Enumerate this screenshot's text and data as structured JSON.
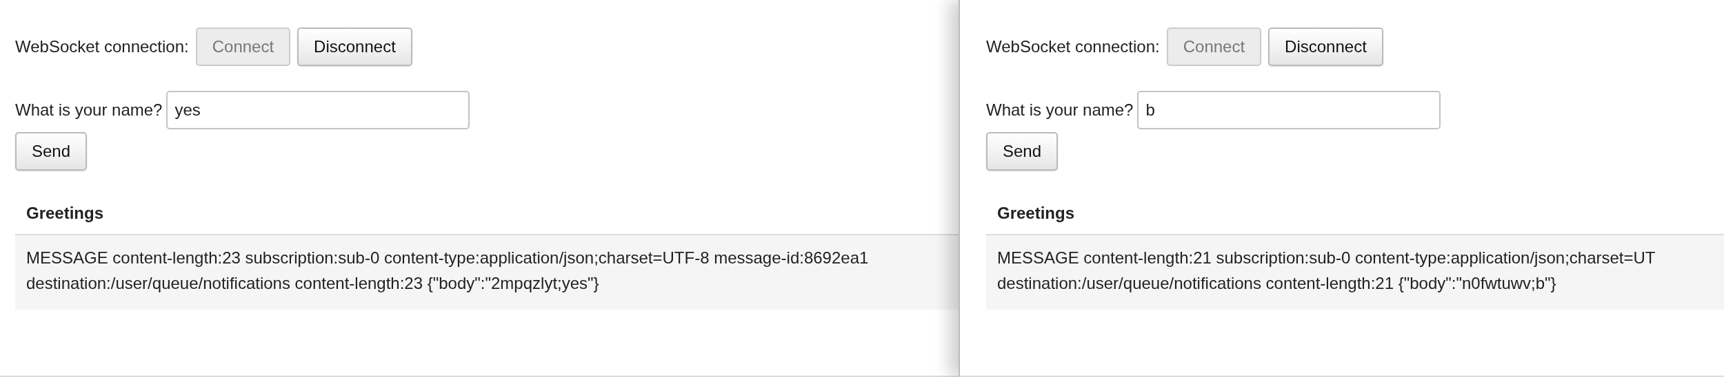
{
  "windows": [
    {
      "connection_label": "WebSocket connection:",
      "buttons": [
        {
          "label": "Connect",
          "disabled": true
        },
        {
          "label": "Disconnect",
          "disabled": false
        }
      ],
      "name_label": "What is your name?",
      "name_value": "yes",
      "send_button": "Send",
      "table_heading": "Greetings",
      "message_lines": [
        "MESSAGE content-length:23 subscription:sub-0 content-type:application/json;charset=UTF-8 message-id:8692ea1",
        "destination:/user/queue/notifications content-length:23 {\"body\":\"2mpqzlyt;yes\"}"
      ]
    },
    {
      "connection_label": "WebSocket connection:",
      "buttons": [
        {
          "label": "Connect",
          "disabled": true
        },
        {
          "label": "Disconnect",
          "disabled": false
        }
      ],
      "name_label": "What is your name?",
      "name_value": "b",
      "send_button": "Send",
      "table_heading": "Greetings",
      "message_lines": [
        "MESSAGE content-length:21 subscription:sub-0 content-type:application/json;charset=UT",
        "destination:/user/queue/notifications content-length:21 {\"body\":\"n0fwtuwv;b\"}"
      ]
    }
  ]
}
